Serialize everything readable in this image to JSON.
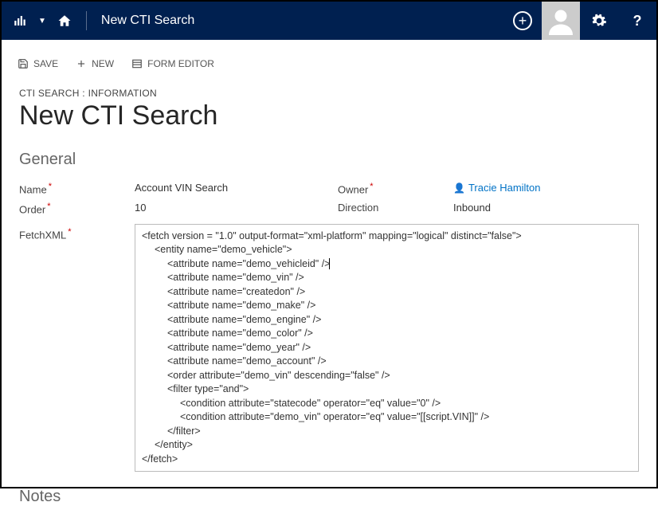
{
  "header": {
    "title": "New CTI Search"
  },
  "toolbar": {
    "save": "SAVE",
    "new": "NEW",
    "form_editor": "FORM EDITOR"
  },
  "breadcrumb": "CTI SEARCH : INFORMATION",
  "heading": "New CTI Search",
  "sections": {
    "general": "General",
    "notes": "Notes"
  },
  "fields": {
    "name_label": "Name",
    "name_value": "Account VIN Search",
    "owner_label": "Owner",
    "owner_value": "Tracie Hamilton",
    "order_label": "Order",
    "order_value": "10",
    "direction_label": "Direction",
    "direction_value": "Inbound",
    "fetchxml_label": "FetchXML"
  },
  "fetchxml": {
    "l0": "<fetch version = \"1.0\" output-format=\"xml-platform\" mapping=\"logical\" distinct=\"false\">",
    "l1": "<entity name=\"demo_vehicle\">",
    "l2": "<attribute name=\"demo_vehicleid\" />",
    "l3": "<attribute name=\"demo_vin\" />",
    "l4": "<attribute name=\"createdon\" />",
    "l5": "<attribute name=\"demo_make\" />",
    "l6": "<attribute name=\"demo_engine\" />",
    "l7": "<attribute name=\"demo_color\" />",
    "l8": "<attribute name=\"demo_year\" />",
    "l9": "<attribute name=\"demo_account\" />",
    "l10": "<order attribute=\"demo_vin\" descending=\"false\" />",
    "l11": "<filter type=\"and\">",
    "l12": "<condition attribute=\"statecode\" operator=\"eq\" value=\"0\" />",
    "l13": "<condition attribute=\"demo_vin\" operator=\"eq\" value=\"[[script.VIN]]\" />",
    "l14": "</filter>",
    "l15": "</entity>",
    "l16": "</fetch>"
  }
}
